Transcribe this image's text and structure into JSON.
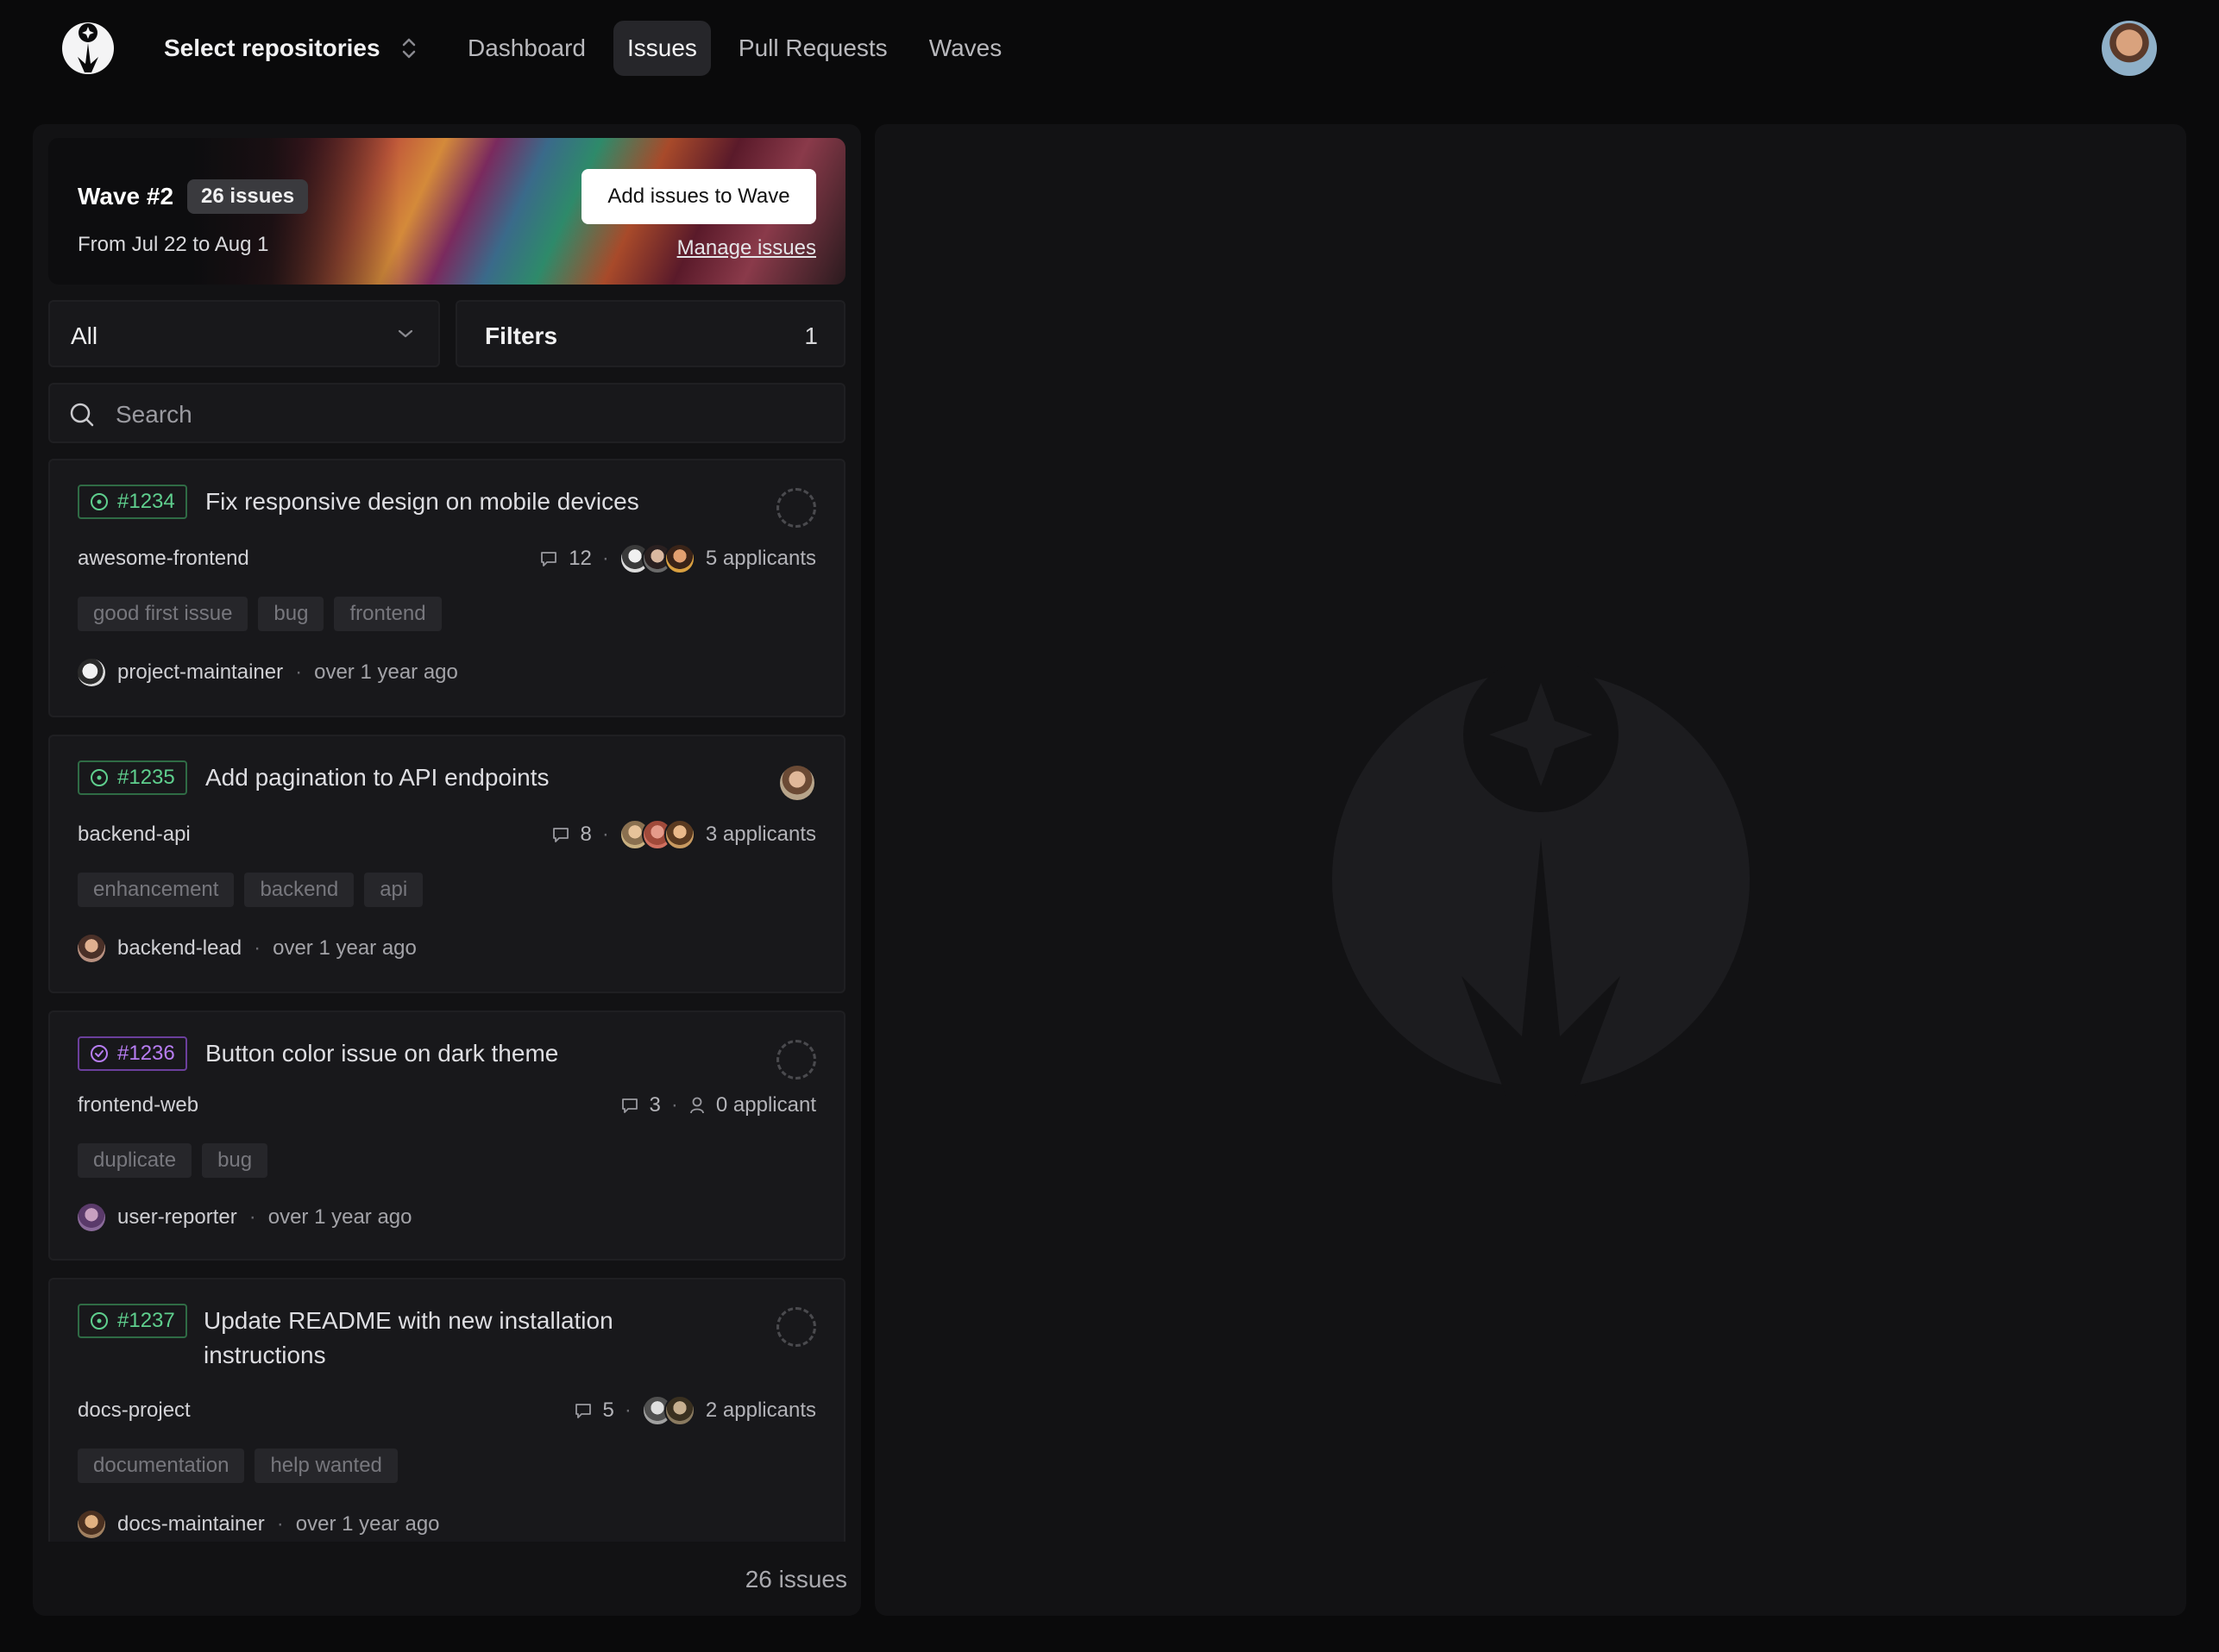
{
  "nav": {
    "repo_select": "Select repositories",
    "items": [
      {
        "label": "Dashboard",
        "active": false
      },
      {
        "label": "Issues",
        "active": true
      },
      {
        "label": "Pull Requests",
        "active": false
      },
      {
        "label": "Waves",
        "active": false
      }
    ]
  },
  "wave": {
    "title": "Wave #2",
    "count": "26 issues",
    "dates": "From Jul 22 to Aug 1",
    "add_button": "Add issues to Wave",
    "manage_link": "Manage issues"
  },
  "filters": {
    "select_value": "All",
    "filters_label": "Filters",
    "filters_count": "1"
  },
  "search": {
    "placeholder": "Search"
  },
  "issues": [
    {
      "number": "#1234",
      "state": "open",
      "title": "Fix responsive design on mobile devices",
      "repo": "awesome-frontend",
      "comments": "12",
      "applicants": "5 applicants",
      "tags": [
        "good first issue",
        "bug",
        "frontend"
      ],
      "author": "project-maintainer",
      "time": "over 1 year ago"
    },
    {
      "number": "#1235",
      "state": "open",
      "title": "Add pagination to API endpoints",
      "repo": "backend-api",
      "comments": "8",
      "applicants": "3 applicants",
      "tags": [
        "enhancement",
        "backend",
        "api"
      ],
      "author": "backend-lead",
      "time": "over 1 year ago"
    },
    {
      "number": "#1236",
      "state": "closed",
      "title": "Button color issue on dark theme",
      "repo": "frontend-web",
      "comments": "3",
      "applicants": "0 applicant",
      "tags": [
        "duplicate",
        "bug"
      ],
      "author": "user-reporter",
      "time": "over 1 year ago"
    },
    {
      "number": "#1237",
      "state": "open",
      "title_line1": "Update README with new installation",
      "title_line2": "instructions",
      "repo": "docs-project",
      "comments": "5",
      "applicants": "2 applicants",
      "tags": [
        "documentation",
        "help wanted"
      ],
      "author": "docs-maintainer",
      "time": "over 1 year ago"
    }
  ],
  "footer": {
    "count": "26 issues"
  },
  "colors": {
    "open": "#5fcf8e",
    "closed": "#b77df2",
    "background": "#0a0a0b",
    "panel": "#121214"
  }
}
